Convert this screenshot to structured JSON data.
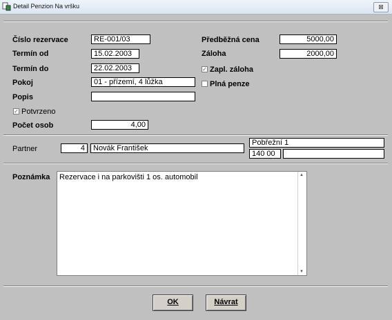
{
  "window": {
    "title": "Detail Penzion Na vršku",
    "close": "⊠",
    "title_icon": "app-icon"
  },
  "reservation": {
    "cislo_label": "Číslo rezervace",
    "cislo_value": "RE-001/03",
    "termin_od_label": "Termín od",
    "termin_od_value": "15.02.2003",
    "termin_do_label": "Termín do",
    "termin_do_value": "22.02.2003",
    "pokoj_label": "Pokoj",
    "pokoj_value": "01 - přízemí, 4 lůžka",
    "popis_label": "Popis",
    "popis_value": "",
    "potvrzeno_label": "Potvrzeno",
    "potvrzeno_checked": true,
    "pocet_osob_label": "Počet osob",
    "pocet_osob_value": "4,00",
    "cena_label": "Předběžná cena",
    "cena_value": "5000,00",
    "zaloha_label": "Záloha",
    "zaloha_value": "2000,00",
    "zapl_zaloha_label": "Zapl. záloha",
    "zapl_zaloha_checked": true,
    "plna_penze_label": "Plná penze",
    "plna_penze_checked": false
  },
  "partner": {
    "label": "Partner",
    "id": "4",
    "name": "Novák František",
    "street": "Pobřežní 1",
    "zip": "140 00",
    "city": ""
  },
  "note": {
    "label": "Poznámka",
    "text": "Rezervace i na parkovišti 1 os. automobil"
  },
  "buttons": {
    "ok_label": "OK",
    "navrat_label": "Návrat"
  }
}
